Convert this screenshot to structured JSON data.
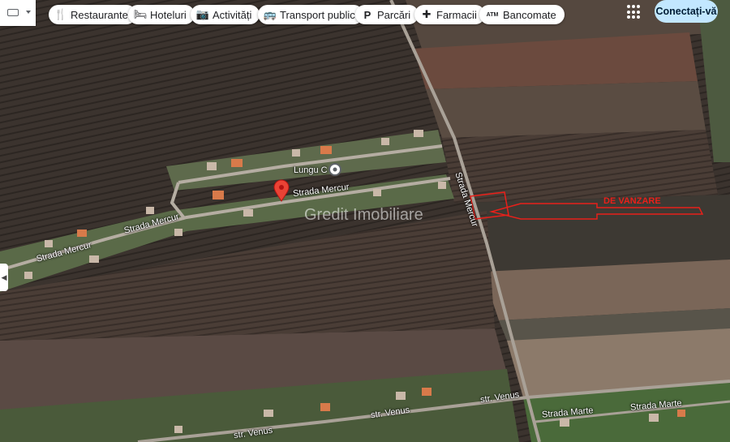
{
  "toolbar": {
    "chips": [
      {
        "label": "Restaurante",
        "icon": "restaurant-icon"
      },
      {
        "label": "Hoteluri",
        "icon": "hotel-icon"
      },
      {
        "label": "Activități",
        "icon": "camera-icon"
      },
      {
        "label": "Transport public",
        "icon": "bus-icon"
      },
      {
        "label": "Parcări",
        "icon": "parking-icon"
      },
      {
        "label": "Farmacii",
        "icon": "pharmacy-icon"
      },
      {
        "label": "Bancomate",
        "icon": "atm-icon"
      }
    ],
    "signin_label": "Conectați-vă"
  },
  "map": {
    "labels": {
      "place": "Lungu C",
      "street_pin": "Strada Mercur",
      "street_left": "Strada Mercur",
      "street_left2": "Strada Mercur",
      "street_vertical": "Strada Mercur",
      "venus1": "str. Venus",
      "venus2": "str. Venus",
      "venus3": "str. Venus",
      "marte1": "Strada Marte",
      "marte2": "Strada Marte"
    },
    "watermark": "Gredit Imobiliare",
    "annotation": "DE VANZARE",
    "pin_color": "#ea4335",
    "annotation_color": "#e8201a"
  }
}
